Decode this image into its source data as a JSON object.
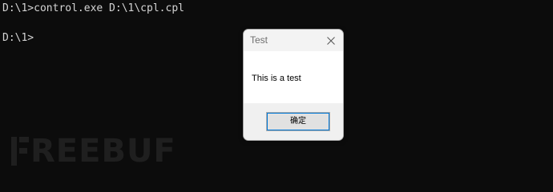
{
  "terminal": {
    "line1": "D:\\1>control.exe D:\\1\\cpl.cpl",
    "line2": "D:\\1>"
  },
  "dialog": {
    "title": "Test",
    "message": "This is a test",
    "ok_label": "确定",
    "close_icon": "close-icon"
  },
  "watermark": {
    "text": "REEBUF"
  },
  "colors": {
    "terminal_bg": "#0c0c0c",
    "terminal_text": "#d4d4d4",
    "dialog_bg": "#ffffff",
    "dialog_footer": "#f0f0f0",
    "focus_accent": "#0078d7"
  }
}
